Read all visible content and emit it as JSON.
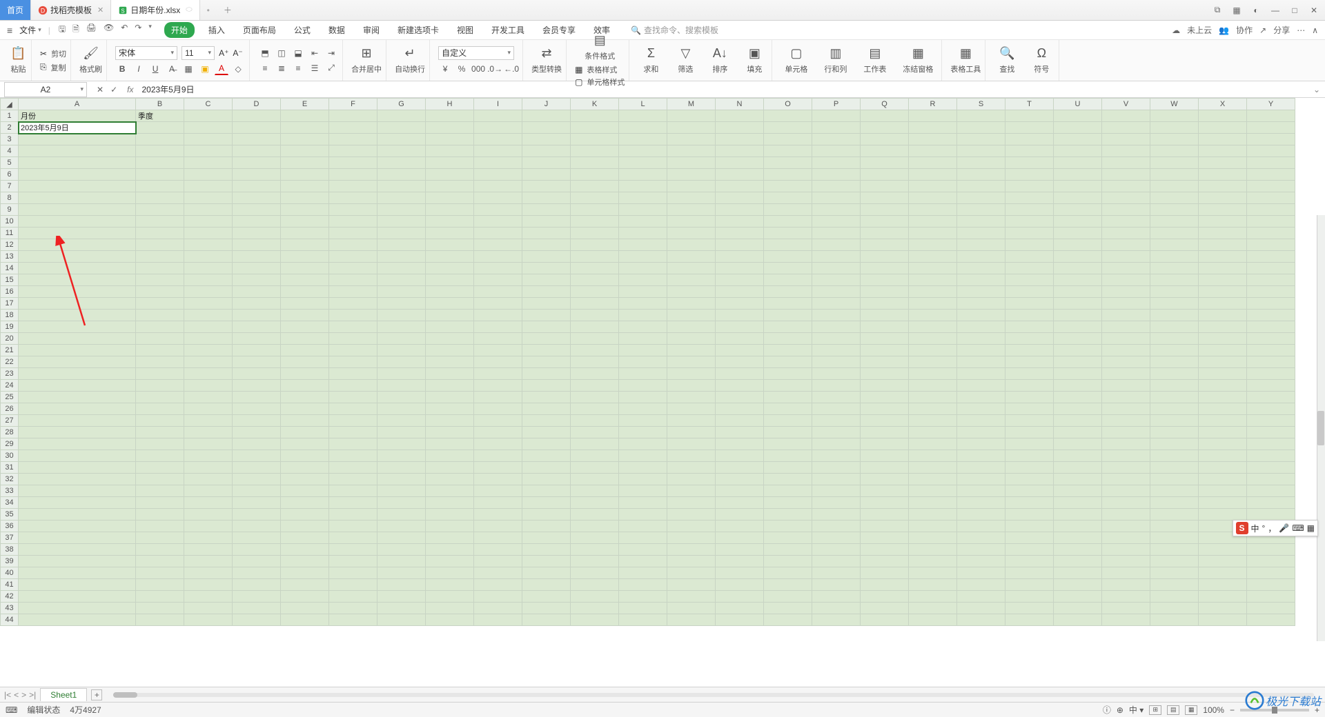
{
  "tabs": {
    "home": "首页",
    "template": "找稻壳模板",
    "file": "日期年份.xlsx"
  },
  "window": {
    "layout": "⧉",
    "grid": "▦",
    "skin": "◐",
    "min": "—",
    "max": "□",
    "close": "✕"
  },
  "file_menu": "文件",
  "menus": {
    "start": "开始",
    "insert": "插入",
    "layout": "页面布局",
    "formula": "公式",
    "data": "数据",
    "review": "审阅",
    "newtab": "新建选项卡",
    "view": "视图",
    "dev": "开发工具",
    "member": "会员专享",
    "effect": "效率"
  },
  "search_placeholder": "查找命令、搜索模板",
  "cloud": {
    "notloud": "未上云",
    "collab": "协作",
    "share": "分享"
  },
  "ribbon": {
    "paste": "粘贴",
    "cut": "剪切",
    "copy": "复制",
    "brush": "格式刷",
    "font_name": "宋体",
    "font_size": "11",
    "merge": "合并居中",
    "wrap": "自动换行",
    "numfmt": "自定义",
    "typeconv": "类型转换",
    "cond": "条件格式",
    "tablestyle": "表格样式",
    "cellstyle": "单元格样式",
    "sum": "求和",
    "filter": "筛选",
    "sort": "排序",
    "fill": "填充",
    "cell": "单元格",
    "rowcol": "行和列",
    "sheet": "工作表",
    "freeze": "冻结窗格",
    "tabletool": "表格工具",
    "find": "查找",
    "symbol": "符号"
  },
  "namebox": "A2",
  "formula": "2023年5月9日",
  "columns": [
    "A",
    "B",
    "C",
    "D",
    "E",
    "F",
    "G",
    "H",
    "I",
    "J",
    "K",
    "L",
    "M",
    "N",
    "O",
    "P",
    "Q",
    "R",
    "S",
    "T",
    "U",
    "V",
    "W",
    "X",
    "Y"
  ],
  "cells": {
    "A1": "月份",
    "B1": "季度",
    "A2": "2023年5月9日"
  },
  "sheet": {
    "name": "Sheet1"
  },
  "status": {
    "mode": "编辑状态",
    "count": "4万4927",
    "zoom": "100%"
  },
  "ime": {
    "cn": "中",
    "dot": "°",
    "comma": "，",
    "mic": "🎤",
    "kb": "⌨",
    "grid": "▦"
  },
  "watermark": "极光下载站"
}
